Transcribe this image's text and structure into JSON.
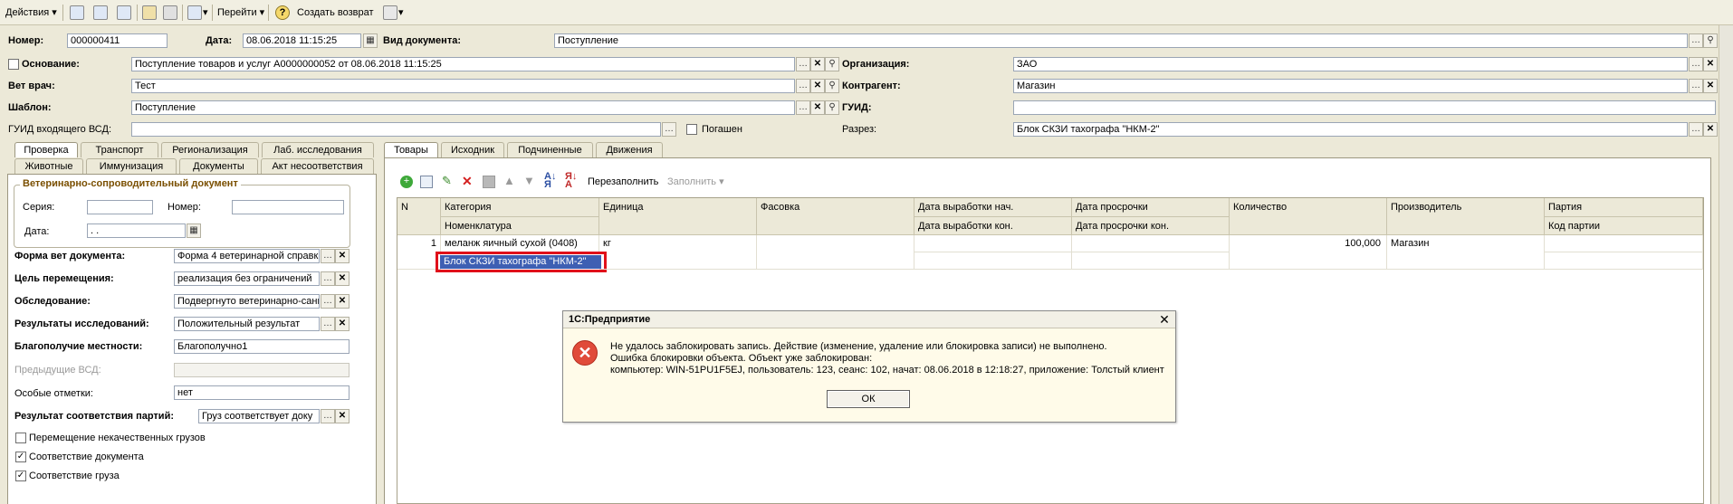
{
  "toolbar": {
    "actions_label": "Действия",
    "goto_label": "Перейти",
    "help_label": "?",
    "create_return_label": "Создать возврат"
  },
  "header": {
    "number_label": "Номер:",
    "number_value": "000000411",
    "date_label": "Дата:",
    "date_value": "08.06.2018 11:15:25",
    "doc_type_label": "Вид документа:",
    "doc_type_value": "Поступление",
    "basis_label": "Основание:",
    "basis_value": "Поступление товаров и услуг А0000000052 от 08.06.2018 11:15:25",
    "vet_label": "Вет врач:",
    "vet_value": "Тест",
    "template_label": "Шаблон:",
    "template_value": "Поступление",
    "guid_in_label": "ГУИД входящего ВСД:",
    "guid_in_value": "",
    "redeemed_label": "Погашен",
    "org_label": "Организация:",
    "org_value": "ЗАО",
    "counterparty_label": "Контрагент:",
    "counterparty_value": "Магазин",
    "guid_label": "ГУИД:",
    "guid_value": "",
    "section_label": "Разрез:",
    "section_value": "Блок СКЗИ тахографа \"НКМ-2\""
  },
  "left_tabs": {
    "row1": [
      "Проверка",
      "Транспорт",
      "Регионализация",
      "Лаб. исследования"
    ],
    "row2": [
      "Животные",
      "Иммунизация",
      "Документы",
      "Акт несоответствия"
    ]
  },
  "left_panel": {
    "group_title": "Ветеринарно-сопроводительный документ",
    "series_label": "Серия:",
    "series_value": "",
    "number_label": "Номер:",
    "number_value": "",
    "date_label": "Дата:",
    "date_value": " .  .",
    "form_label": "Форма вет документа:",
    "form_value": "Форма 4 ветеринарной справк",
    "purpose_label": "Цель перемещения:",
    "purpose_value": "реализация без ограничений",
    "inspection_label": "Обследование:",
    "inspection_value": "Подвергнуто ветеринарно-сани",
    "results_label": "Результаты исследований:",
    "results_value": "Положительный результат",
    "locality_label": "Благополучие местности:",
    "locality_value": "Благополучно1",
    "prev_vsd_label": "Предыдущие ВСД:",
    "prev_vsd_value": "",
    "notes_label": "Особые отметки:",
    "notes_value": "нет",
    "match_label": "Результат соответствия партий:",
    "match_value": "Груз соответствует доку",
    "cb_bad_cargo_label": "Перемещение некачественных грузов",
    "cb_doc_match_label": "Соответствие документа",
    "cb_cargo_match_label": "Соответствие груза"
  },
  "right_tabs": [
    "Товары",
    "Исходник",
    "Подчиненные",
    "Движения"
  ],
  "grid_toolbar": {
    "refill_label": "Перезаполнить",
    "fill_label": "Заполнить"
  },
  "grid": {
    "headers_row1": [
      "N",
      "Категория",
      "Единица",
      "Фасовка",
      "Дата выработки нач.",
      "Дата просрочки",
      "Количество",
      "Производитель",
      "Партия"
    ],
    "headers_row2": [
      "",
      "Номенклатура",
      "",
      "",
      "Дата выработки кон.",
      "Дата просрочки кон.",
      "",
      "",
      "Код партии"
    ],
    "rows": [
      {
        "n": "1",
        "category": "меланж яичный сухой (0408)",
        "nomenclature": "Блок СКЗИ тахографа \"НКМ-2\"",
        "unit": "кг",
        "quantity": "100,000",
        "producer": "Магазин"
      }
    ]
  },
  "dialog": {
    "title": "1С:Предприятие",
    "line1": "Не удалось заблокировать запись. Действие (изменение, удаление или блокировка записи) не выполнено.",
    "line2": "Ошибка блокировки объекта. Объект уже заблокирован:",
    "line3": "компьютер: WIN-51PU1F5EJ, пользователь: 123, сеанс: 102, начат: 08.06.2018 в 12:18:27, приложение: Толстый клиент",
    "ok_label": "ОК",
    "close_symbol": "✕"
  },
  "colors": {
    "selection": "#3e5fb3",
    "highlight_border": "#e0101a",
    "legend_text": "#7a4f00"
  }
}
